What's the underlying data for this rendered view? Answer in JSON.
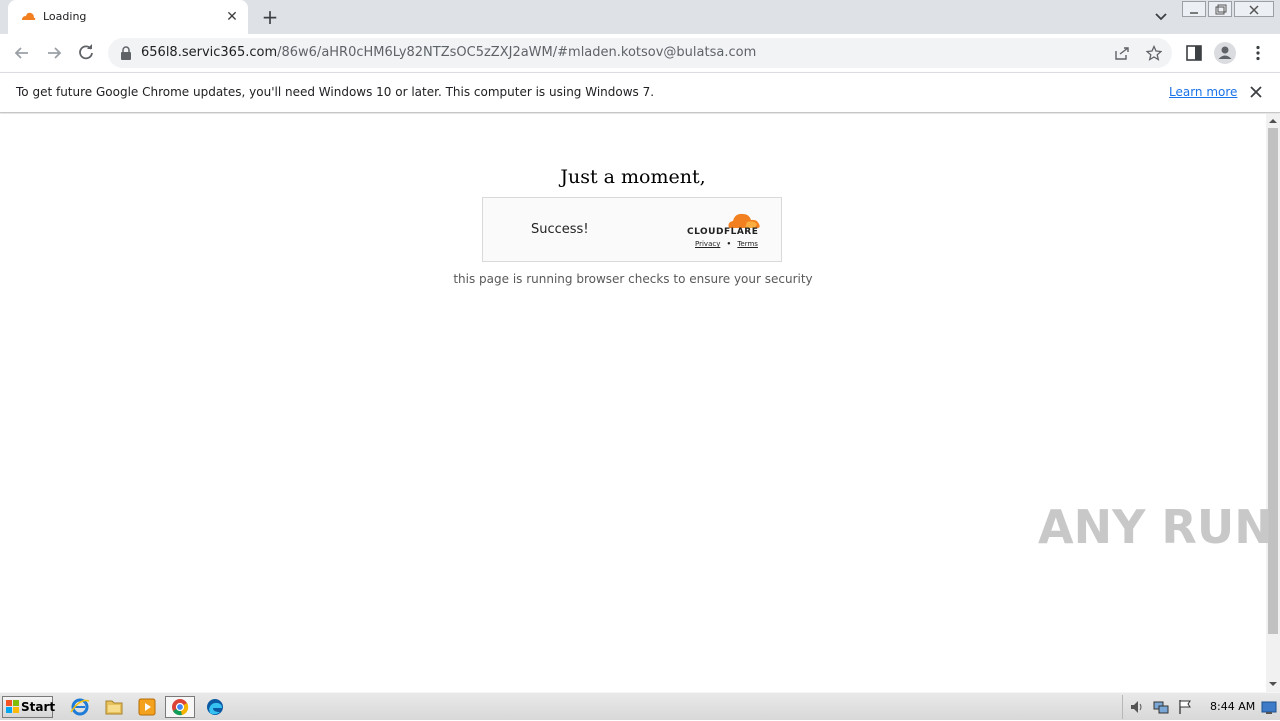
{
  "browser": {
    "tab": {
      "title": "Loading",
      "favicon": "cloudflare-icon"
    },
    "url": {
      "host": "656l8.servic365.com",
      "path": "/86w6/aHR0cHM6Ly82NTZsOC5zZXJ2aWM/#mladen.kotsov@bulatsa.com"
    },
    "infobar": {
      "message": "To get future Google Chrome updates, you'll need Windows 10 or later. This computer is using Windows 7.",
      "link": "Learn more"
    }
  },
  "page": {
    "heading": "Just a moment,",
    "challenge": {
      "status": "Success!",
      "brand": "CLOUDFLARE",
      "privacy": "Privacy",
      "separator": "•",
      "terms": "Terms"
    },
    "subtext": "this page is running browser checks to ensure your security"
  },
  "watermark": "ANY RUN",
  "taskbar": {
    "start": "Start",
    "apps": [
      "internet-explorer-icon",
      "file-explorer-icon",
      "media-player-icon",
      "chrome-icon",
      "edge-icon"
    ],
    "clock": "8:44 AM"
  },
  "colors": {
    "accent": "#1a73e8",
    "cloudflare_orange": "#f38020",
    "tabstrip": "#dee1e6"
  }
}
